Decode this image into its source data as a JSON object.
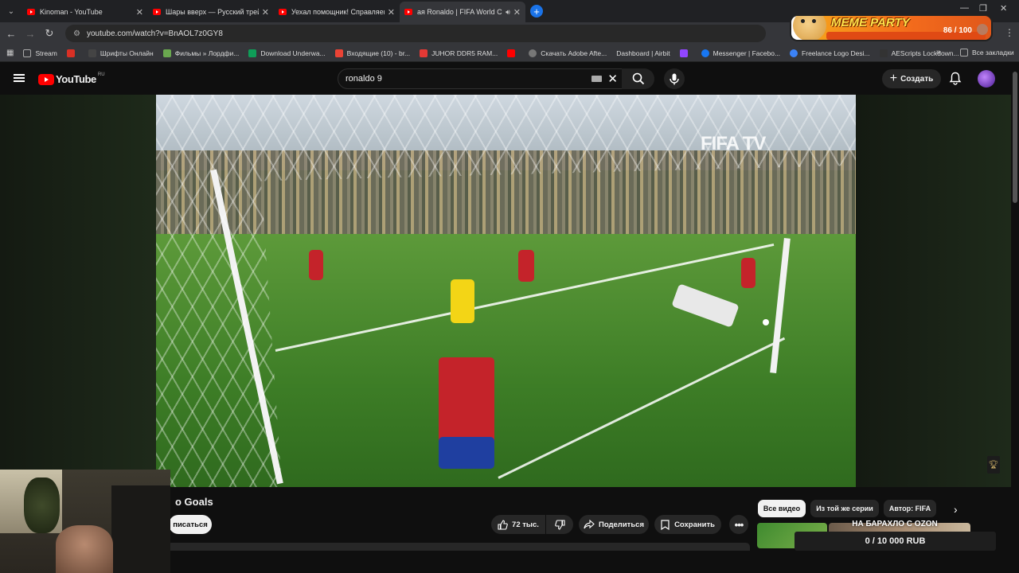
{
  "browser": {
    "tabs": [
      {
        "title": "Kinoman - YouTube"
      },
      {
        "title": "Шары вверх — Русский трейл"
      },
      {
        "title": "Уехал помощник! Справляемс"
      },
      {
        "title": "ая Ronaldo | FIFA World Cup"
      }
    ],
    "url": "youtube.com/watch?v=BnAOL7z0GY8",
    "bookmarks": [
      {
        "label": "Stream",
        "color": "#5f6368"
      },
      {
        "label": "",
        "color": "#d93025"
      },
      {
        "label": "Шрифты Онлайн",
        "color": "#444"
      },
      {
        "label": "Фильмы » Лордфи...",
        "color": "#6aa84f"
      },
      {
        "label": "Download Underwa...",
        "color": "#0f9d58"
      },
      {
        "label": "Входящие (10) - br...",
        "color": "#ea4335"
      },
      {
        "label": "JUHOR DDR5 RAM...",
        "color": "#e53935"
      },
      {
        "label": "Скачать Adobe Afte...",
        "color": "#ff0000"
      },
      {
        "label": "Dashboard | Airbit",
        "color": "#777"
      },
      {
        "label": "",
        "color": "#9146ff"
      },
      {
        "label": "Messenger | Facebo...",
        "color": "#1877f2"
      },
      {
        "label": "Freelance Logo Desi...",
        "color": "#3b82f6"
      },
      {
        "label": "AEScripts Lockdown...",
        "color": "#333"
      }
    ],
    "all_bookmarks": "Все закладки"
  },
  "meme_widget": {
    "title": "MEME PARTY",
    "count": "86 / 100",
    "progress": 0.86
  },
  "youtube": {
    "logo": "YouTube",
    "region": "RU",
    "search_value": "ronaldo 9",
    "create_label": "Создать"
  },
  "video": {
    "watermark": "FIFA TV",
    "title": "o Goals",
    "subscribe_label": "писаться",
    "likes": "72 тыс.",
    "share_label": "Поделиться",
    "save_label": "Сохранить"
  },
  "related": {
    "chips": [
      "Все видео",
      "Из той же серии",
      "Автор: FIFA"
    ]
  },
  "donation": {
    "banner": "НА БАРАХЛО С OZON",
    "amount": "0 / 10 000 RUB"
  },
  "icons": {
    "search": "search-icon",
    "mic": "mic-icon",
    "bell": "bell-icon",
    "like": "thumbs-up-icon",
    "dislike": "thumbs-down-icon",
    "share": "share-icon",
    "save": "bookmark-icon",
    "more": "more-icon"
  }
}
